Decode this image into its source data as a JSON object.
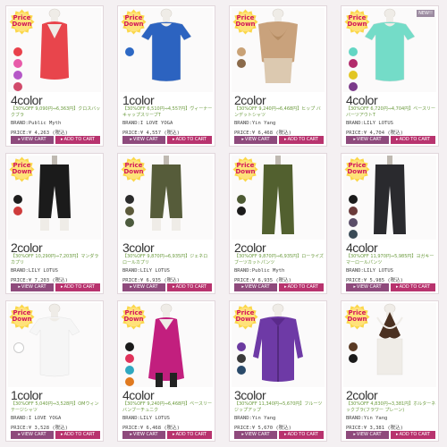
{
  "badge_line1": "Price",
  "badge_line2": "Down",
  "new_tag": "NEW!!",
  "view_label": "VIEW CART",
  "cart_label": "ADD TO CART",
  "products": [
    {
      "count": "4color",
      "desc": "【30%OFF 9,090円⇒6,363円】クロスバックブラ",
      "brand": "BRAND:Public Myth",
      "price": "PRICE:¥ 4,263 (税込)",
      "colors": [
        "#e9414b",
        "#e85ba9",
        "#b557c7",
        "#d14a6a"
      ],
      "garment": "tank",
      "gcolor": "#e8454c",
      "new": false
    },
    {
      "count": "1color",
      "desc": "【30%OFF 6,510円⇒4,557円】ヴィーナーキャップスリーブT",
      "brand": "BRAND:I LOVE YOGA",
      "price": "PRICE:¥ 4,557 (税込)",
      "colors": [
        "#2d68c4"
      ],
      "garment": "tee",
      "gcolor": "#2c63c0",
      "new": false
    },
    {
      "count": "2color",
      "desc": "【30%OFF 9,240円⇒6,468円】ヒップ バンデットシャツ",
      "brand": "BRAND:Yin Yang",
      "price": "PRICE:¥ 6,468 (税込)",
      "colors": [
        "#c9a276",
        "#8a6a4a"
      ],
      "garment": "drape",
      "gcolor": "#c9a27c",
      "new": false
    },
    {
      "count": "4color",
      "desc": "【30%OFF 6,720円⇒4,704円】ベースリーバーツアウトT",
      "brand": "BRAND:LILY LOTUS",
      "price": "PRICE:¥ 4,704 (税込)",
      "colors": [
        "#63d6c4",
        "#b22b6c",
        "#e2c623",
        "#7b3a8a"
      ],
      "garment": "tee",
      "gcolor": "#74dcc8",
      "new": true
    },
    {
      "count": "2color",
      "desc": "【30%OFF 10,290円⇒7,203円】マンダラカプリ",
      "brand": "BRAND:LILY LOTUS",
      "price": "PRICE:¥ 7,203 (税込)",
      "colors": [
        "#1d1d1d",
        "#cf3c3c"
      ],
      "garment": "capri",
      "gcolor": "#1b1b1b",
      "new": false
    },
    {
      "count": "3color",
      "desc": "【30%OFF 9,870円⇒6,935円】ジェネロ ロールカプリ",
      "brand": "BRAND:LILY LOTUS",
      "price": "PRICE:¥ 6,935 (税込)",
      "colors": [
        "#2b2b2b",
        "#5c5a3a",
        "#4c5a3d"
      ],
      "garment": "capri",
      "gcolor": "#565c3a",
      "new": false
    },
    {
      "count": "2color",
      "desc": "【30%OFF 9,870円⇒6,935円】ローライズブーツカットパンツ",
      "brand": "BRAND:Public Myth",
      "price": "PRICE:¥ 6,935 (税込)",
      "colors": [
        "#4d5a33",
        "#1b1b1b"
      ],
      "garment": "pants",
      "gcolor": "#52602f",
      "new": false
    },
    {
      "count": "4color",
      "desc": "【30%OFF 11,970円⇒5,985円】ヨガキーマーロールパンツ",
      "brand": "BRAND:LILY LOTUS",
      "price": "PRICE:¥ 5,985 (税込)",
      "colors": [
        "#1a1a1a",
        "#6a3a3a",
        "#5a4d68",
        "#3a4a56"
      ],
      "garment": "pants",
      "gcolor": "#2a2a2e",
      "new": false
    },
    {
      "count": "1color",
      "desc": "【30%OFF 5,040円⇒3,528円】OMウィンテージシャツ",
      "brand": "BRAND:I LOVE YOGA",
      "price": "PRICE:¥ 3,528 (税込)",
      "colors": [
        "#ffffff"
      ],
      "garment": "tee",
      "gcolor": "#f6f6f6",
      "new": false
    },
    {
      "count": "4color",
      "desc": "【30%OFF 9,240円⇒6,468円】ベースリーバンブーチュニク",
      "brand": "BRAND:LILY LOTUS",
      "price": "PRICE:¥ 6,468 (税込)",
      "colors": [
        "#1a1a1a",
        "#e0325a",
        "#2fa8c0",
        "#e07a20"
      ],
      "garment": "tunic",
      "gcolor": "#c21f7e",
      "new": false
    },
    {
      "count": "3color",
      "desc": "【30%OFF 11,340円⇒5,670円】フルーツジップアップ",
      "brand": "BRAND:Yin Yang",
      "price": "PRICE:¥ 5,670 (税込)",
      "colors": [
        "#6b3aa0",
        "#3a3a3a",
        "#2a4a6a"
      ],
      "garment": "jacket",
      "gcolor": "#6e3aa6",
      "new": false
    },
    {
      "count": "2color",
      "desc": "【30%OFF 4,830円⇒3,381円】ホルターネックブラ(フラワー プレーン)",
      "brand": "BRAND:Yin Yang",
      "price": "PRICE:¥ 3,381 (税込)",
      "colors": [
        "#5a3a24",
        "#1a1a1a"
      ],
      "garment": "halter",
      "gcolor": "#4a3020",
      "new": false
    }
  ]
}
